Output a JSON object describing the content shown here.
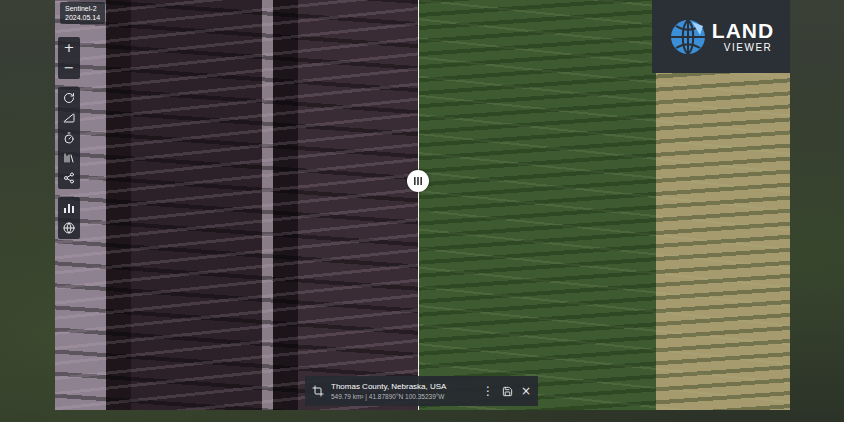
{
  "scene": {
    "sensor": "Sentinel-2",
    "date": "2024.05.14"
  },
  "logo": {
    "line1": "LAND",
    "line2": "VIEWER"
  },
  "zoom": {
    "in": "+",
    "out": "−"
  },
  "location": {
    "name": "Thomas County, Nebraska, USA",
    "details": "549.79 km² | 41.87890°N 100.35239°W",
    "more": "⋮",
    "close": "×"
  }
}
